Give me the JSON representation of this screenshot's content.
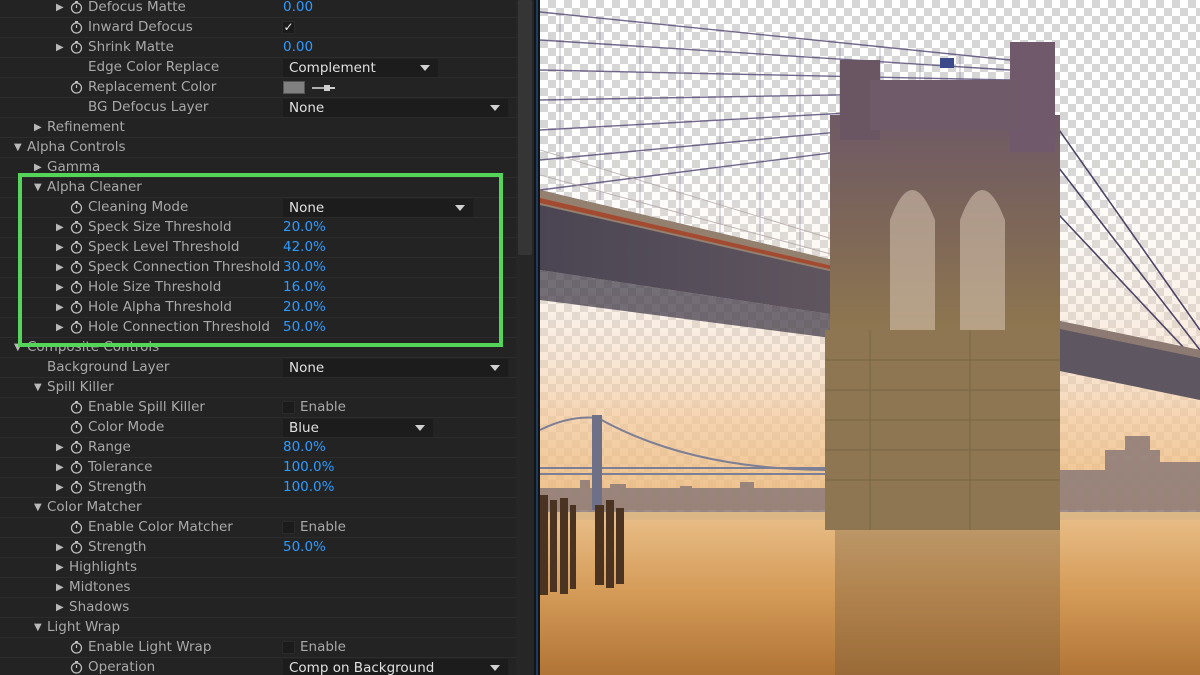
{
  "rows": [
    {
      "indent": 1,
      "twirl": true,
      "stopwatch": true,
      "label": "Defocus Matte",
      "type": "number",
      "value": "0.00"
    },
    {
      "indent": 1,
      "twirl": false,
      "stopwatch": true,
      "label": "Inward Defocus",
      "type": "checkbox",
      "checked": true,
      "cb_label": ""
    },
    {
      "indent": 1,
      "twirl": true,
      "stopwatch": true,
      "label": "Shrink Matte",
      "type": "number",
      "value": "0.00"
    },
    {
      "indent": 1,
      "twirl": false,
      "stopwatch": false,
      "label": "Edge Color Replace",
      "type": "dropdown",
      "value": "Complement",
      "ddw": 155
    },
    {
      "indent": 1,
      "twirl": false,
      "stopwatch": true,
      "label": "Replacement Color",
      "type": "color",
      "color": "#808080"
    },
    {
      "indent": 1,
      "twirl": false,
      "stopwatch": false,
      "label": "BG Defocus Layer",
      "type": "dropdown",
      "value": "None",
      "ddw": 225
    },
    {
      "indent": 0,
      "twirl": "closed",
      "stopwatch": false,
      "label": "Refinement",
      "type": "group"
    },
    {
      "indent": -1,
      "twirl": "open",
      "stopwatch": false,
      "label": "Alpha Controls",
      "type": "group"
    },
    {
      "indent": 0,
      "twirl": "closed",
      "stopwatch": false,
      "label": "Gamma",
      "type": "group"
    },
    {
      "indent": 0,
      "twirl": "open",
      "stopwatch": false,
      "label": "Alpha Cleaner",
      "type": "group"
    },
    {
      "indent": 1,
      "twirl": false,
      "stopwatch": true,
      "label": "Cleaning Mode",
      "type": "dropdown",
      "value": "None",
      "ddw": 190
    },
    {
      "indent": 1,
      "twirl": true,
      "stopwatch": true,
      "label": "Speck Size Threshold",
      "type": "number",
      "value": "20.0%"
    },
    {
      "indent": 1,
      "twirl": true,
      "stopwatch": true,
      "label": "Speck Level Threshold",
      "type": "number",
      "value": "42.0%"
    },
    {
      "indent": 1,
      "twirl": true,
      "stopwatch": true,
      "label": "Speck Connection Threshold",
      "type": "number",
      "value": "30.0%"
    },
    {
      "indent": 1,
      "twirl": true,
      "stopwatch": true,
      "label": "Hole Size Threshold",
      "type": "number",
      "value": "16.0%"
    },
    {
      "indent": 1,
      "twirl": true,
      "stopwatch": true,
      "label": "Hole Alpha Threshold",
      "type": "number",
      "value": "20.0%"
    },
    {
      "indent": 1,
      "twirl": true,
      "stopwatch": true,
      "label": "Hole Connection Threshold",
      "type": "number",
      "value": "50.0%"
    },
    {
      "indent": -1,
      "twirl": "open",
      "stopwatch": false,
      "label": "Composite Controls",
      "type": "group"
    },
    {
      "indent": 0,
      "twirl": false,
      "stopwatch": false,
      "label": "Background Layer",
      "type": "dropdown",
      "value": "None",
      "ddw": 225
    },
    {
      "indent": 0,
      "twirl": "open",
      "stopwatch": false,
      "label": "Spill Killer",
      "type": "group"
    },
    {
      "indent": 1,
      "twirl": false,
      "stopwatch": true,
      "label": "Enable Spill Killer",
      "type": "checkbox",
      "checked": false,
      "cb_label": "Enable"
    },
    {
      "indent": 1,
      "twirl": false,
      "stopwatch": true,
      "label": "Color Mode",
      "type": "dropdown",
      "value": "Blue",
      "ddw": 150
    },
    {
      "indent": 1,
      "twirl": true,
      "stopwatch": true,
      "label": "Range",
      "type": "number",
      "value": "80.0%"
    },
    {
      "indent": 1,
      "twirl": true,
      "stopwatch": true,
      "label": "Tolerance",
      "type": "number",
      "value": "100.0%"
    },
    {
      "indent": 1,
      "twirl": true,
      "stopwatch": true,
      "label": "Strength",
      "type": "number",
      "value": "100.0%"
    },
    {
      "indent": 0,
      "twirl": "open",
      "stopwatch": false,
      "label": "Color Matcher",
      "type": "group"
    },
    {
      "indent": 1,
      "twirl": false,
      "stopwatch": true,
      "label": "Enable Color Matcher",
      "type": "checkbox",
      "checked": false,
      "cb_label": "Enable"
    },
    {
      "indent": 1,
      "twirl": true,
      "stopwatch": true,
      "label": "Strength",
      "type": "number",
      "value": "50.0%"
    },
    {
      "indent": 1,
      "twirl": "closed",
      "stopwatch": false,
      "label": "Highlights",
      "type": "group"
    },
    {
      "indent": 1,
      "twirl": "closed",
      "stopwatch": false,
      "label": "Midtones",
      "type": "group"
    },
    {
      "indent": 1,
      "twirl": "closed",
      "stopwatch": false,
      "label": "Shadows",
      "type": "group"
    },
    {
      "indent": 0,
      "twirl": "open",
      "stopwatch": false,
      "label": "Light Wrap",
      "type": "group"
    },
    {
      "indent": 1,
      "twirl": false,
      "stopwatch": true,
      "label": "Enable Light Wrap",
      "type": "checkbox",
      "checked": false,
      "cb_label": "Enable"
    },
    {
      "indent": 1,
      "twirl": false,
      "stopwatch": true,
      "label": "Operation",
      "type": "dropdown",
      "value": "Comp on Background",
      "ddw": 225
    }
  ],
  "highlight_color": "#55d45a",
  "accent_value_color": "#2d9bff",
  "viewer": {
    "content": "brooklyn-bridge-keyed-composite"
  }
}
